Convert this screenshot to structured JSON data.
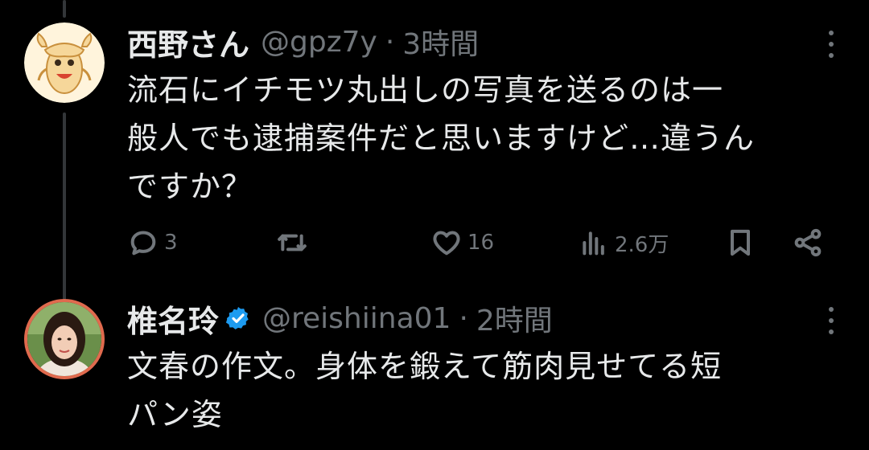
{
  "tweets": [
    {
      "name": "西野さん",
      "handle": "@gpz7y",
      "separator": "·",
      "time": "3時間",
      "verified": false,
      "text_lines": [
        "流石にイチモツ丸出しの写真を送るのは一",
        "般人でも逮捕案件だと思いますけど…違うん",
        "ですか？"
      ],
      "actions": {
        "reply_count": "3",
        "retweet_count": "",
        "like_count": "16",
        "views_count": "2.6万"
      }
    },
    {
      "name": "椎名玲",
      "handle": "@reishiina01",
      "separator": "·",
      "time": "2時間",
      "verified": true,
      "text_lines": [
        "文春の作文。身体を鍛えて筋肉見せてる短",
        "パン姿"
      ]
    }
  ],
  "colors": {
    "background": "#000000",
    "text_primary": "#e7e9ea",
    "text_secondary": "#71767b",
    "verified_blue": "#1d9bf0",
    "thread_line": "#333639"
  },
  "icons": {
    "reply": "reply-bubble-icon",
    "retweet": "retweet-icon",
    "like": "heart-icon",
    "views": "views-bar-chart-icon",
    "bookmark": "bookmark-icon",
    "share": "share-icon",
    "more": "more-vertical-icon",
    "verified": "verified-badge-icon"
  }
}
